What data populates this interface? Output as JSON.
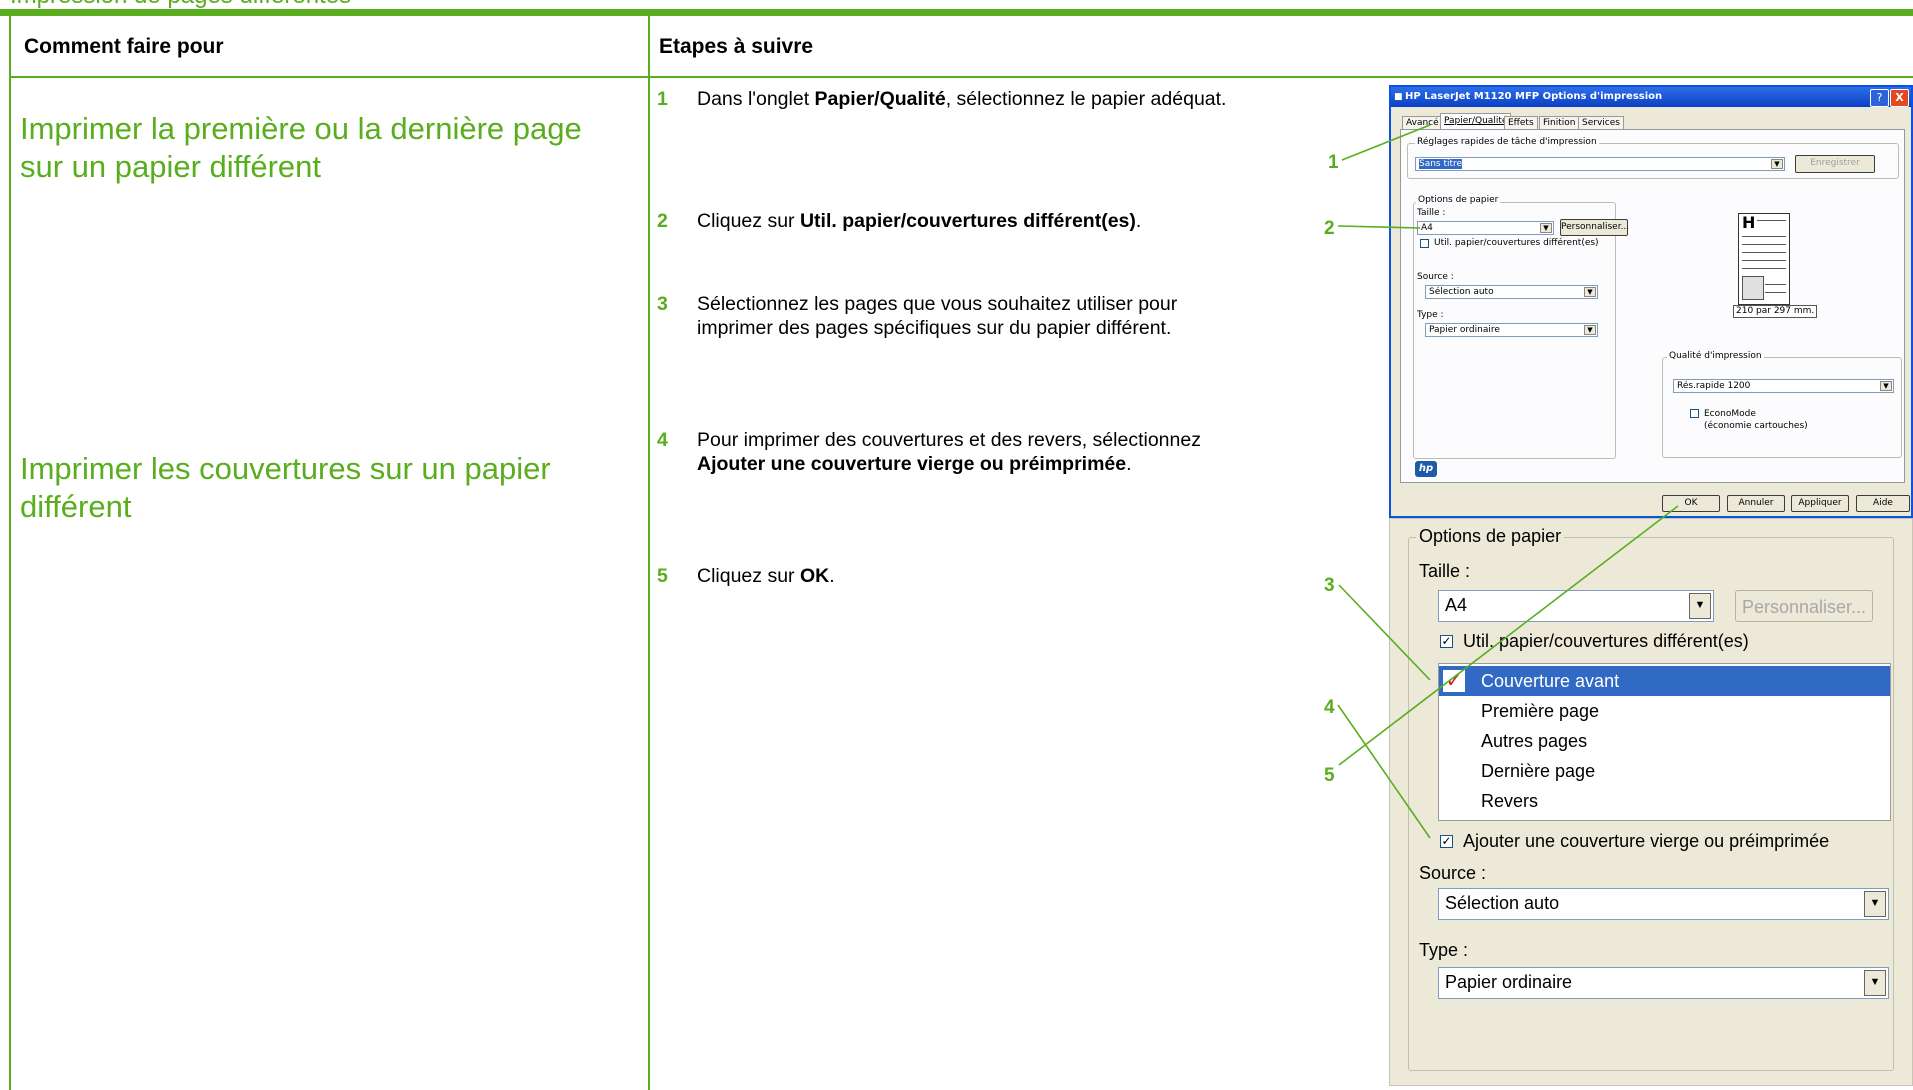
{
  "doc": {
    "top_caption": "Impression de pages différentes",
    "headers": {
      "col1": "Comment faire pour",
      "col2": "Etapes à suivre"
    },
    "tasks": [
      {
        "label": "Imprimer la première ou la dernière page sur un papier différent"
      },
      {
        "label": "Imprimer les couvertures sur un papier différent"
      }
    ],
    "steps": [
      {
        "num": "1",
        "pre": "Dans l'onglet ",
        "bold": "Papier/Qualité",
        "post": ", sélectionnez le papier adéquat."
      },
      {
        "num": "2",
        "pre": "Cliquez sur ",
        "bold": "Util. papier/couvertures différent(es)",
        "post": "."
      },
      {
        "num": "3",
        "pre": "Sélectionnez les pages que vous souhaitez utiliser pour imprimer des pages spécifiques sur du papier différent.",
        "bold": "",
        "post": ""
      },
      {
        "num": "4",
        "pre": "Pour imprimer des couvertures et des revers, sélectionnez ",
        "bold": "Ajouter une couverture vierge ou préimprimée",
        "post": "."
      },
      {
        "num": "5",
        "pre": "Cliquez sur ",
        "bold": "OK",
        "post": "."
      }
    ],
    "callouts": [
      "1",
      "2",
      "3",
      "4",
      "5"
    ]
  },
  "dialog": {
    "title": "HP LaserJet M1120 MFP Options d'impression",
    "tabs": [
      "Avancé",
      "Papier/Qualité",
      "Effets",
      "Finition",
      "Services"
    ],
    "quick_sets_label": "Réglages rapides de tâche d'impression",
    "quick_sets_value": "Sans titre",
    "save_label": "Enregistrer",
    "paper_options_label": "Options de papier",
    "size_label": "Taille :",
    "size_value": "A4",
    "custom_label": "Personnaliser...",
    "diff_paper_label": "Util. papier/couvertures différent(es)",
    "source_label": "Source :",
    "source_value": "Sélection auto",
    "type_label": "Type :",
    "type_value": "Papier ordinaire",
    "preview_size": "210 par 297 mm.",
    "preview_letter": "H",
    "quality_label": "Qualité d'impression",
    "quality_value": "Rés.rapide 1200",
    "economode_label": "EconoMode",
    "economode_sub": "(économie cartouches)",
    "hp_logo": "hp",
    "buttons": {
      "ok": "OK",
      "cancel": "Annuler",
      "apply": "Appliquer",
      "help": "Aide"
    },
    "title_buttons": {
      "help": "?",
      "close": "X"
    }
  },
  "zoom": {
    "paper_options_label": "Options de papier",
    "size_label": "Taille :",
    "size_value": "A4",
    "custom_label": "Personnaliser...",
    "diff_paper_label": "Util. papier/couvertures différent(es)",
    "list_items": [
      "Couverture avant",
      "Première page",
      "Autres pages",
      "Dernière page",
      "Revers"
    ],
    "add_cover_label": "Ajouter une couverture vierge ou préimprimée",
    "source_label": "Source :",
    "source_value": "Sélection auto",
    "type_label": "Type :",
    "type_value": "Papier ordinaire",
    "check_mark": "✓",
    "arrow": "▼"
  },
  "colors": {
    "accent_green": "#5aad1e",
    "xp_blue": "#0a54e0",
    "selection": "#316ac5"
  }
}
